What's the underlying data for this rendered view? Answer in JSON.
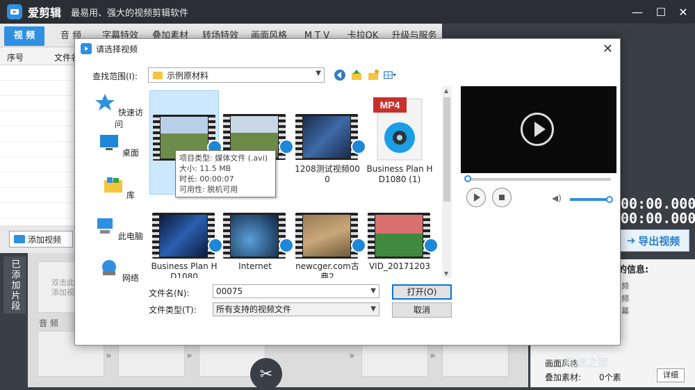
{
  "app": {
    "name": "爱剪辑",
    "slogan": "最易用、强大的视频剪辑软件",
    "menu": [
      "视 频",
      "音 频",
      "字幕特效",
      "叠加素材",
      "转场特效",
      "画面风格",
      "M T V",
      "卡拉OK",
      "升级与服务"
    ],
    "list_headers": [
      "序号",
      "文件名"
    ],
    "add_video_label": "添加视频",
    "side_tab_label": "已添加片段",
    "clip_hint": "双击此\n添加视",
    "audio_label": "音 频",
    "timecodes": [
      "00:00.000",
      "00:00.000"
    ],
    "export_label": "导出视频",
    "info_title": "的信息:",
    "info_lines": [
      "频",
      "频",
      "幕"
    ],
    "bottom_lines": [
      "画面风格",
      "叠加素材:",
      "0个素"
    ],
    "detail_btn": "详细",
    "accent_color": "#2f8fe0"
  },
  "dialog": {
    "title": "请选择视频",
    "lookin_label": "查找范围(I):",
    "lookin_value": "示例原材料",
    "places": [
      "快速访问",
      "桌面",
      "库",
      "此电脑",
      "网络"
    ],
    "files": [
      {
        "name": "0",
        "kind": "avi",
        "selected": true
      },
      {
        "name": "",
        "kind": "avi"
      },
      {
        "name": "1208测试视频000",
        "kind": "video"
      },
      {
        "name": "Business Plan HD1080 (1)",
        "kind": "mp4"
      },
      {
        "name": "Business Plan HD1080",
        "kind": "video"
      },
      {
        "name": "Internet",
        "kind": "video"
      },
      {
        "name": "newcger.com古典2",
        "kind": "video"
      },
      {
        "name": "VID_20171203_...",
        "kind": "video"
      }
    ],
    "tooltip": [
      "项目类型: 媒体文件 (.avi)",
      "大小: 11.5 MB",
      "时长: 00:00:07",
      "可用性: 脱机可用"
    ],
    "filename_label": "文件名(N):",
    "filename_value": "00075",
    "filetype_label": "文件类型(T):",
    "filetype_value": "所有支持的视频文件",
    "open_label": "打开(O)",
    "cancel_label": "取消",
    "mp4_badge": "MP4"
  },
  "watermark": "系统之家"
}
